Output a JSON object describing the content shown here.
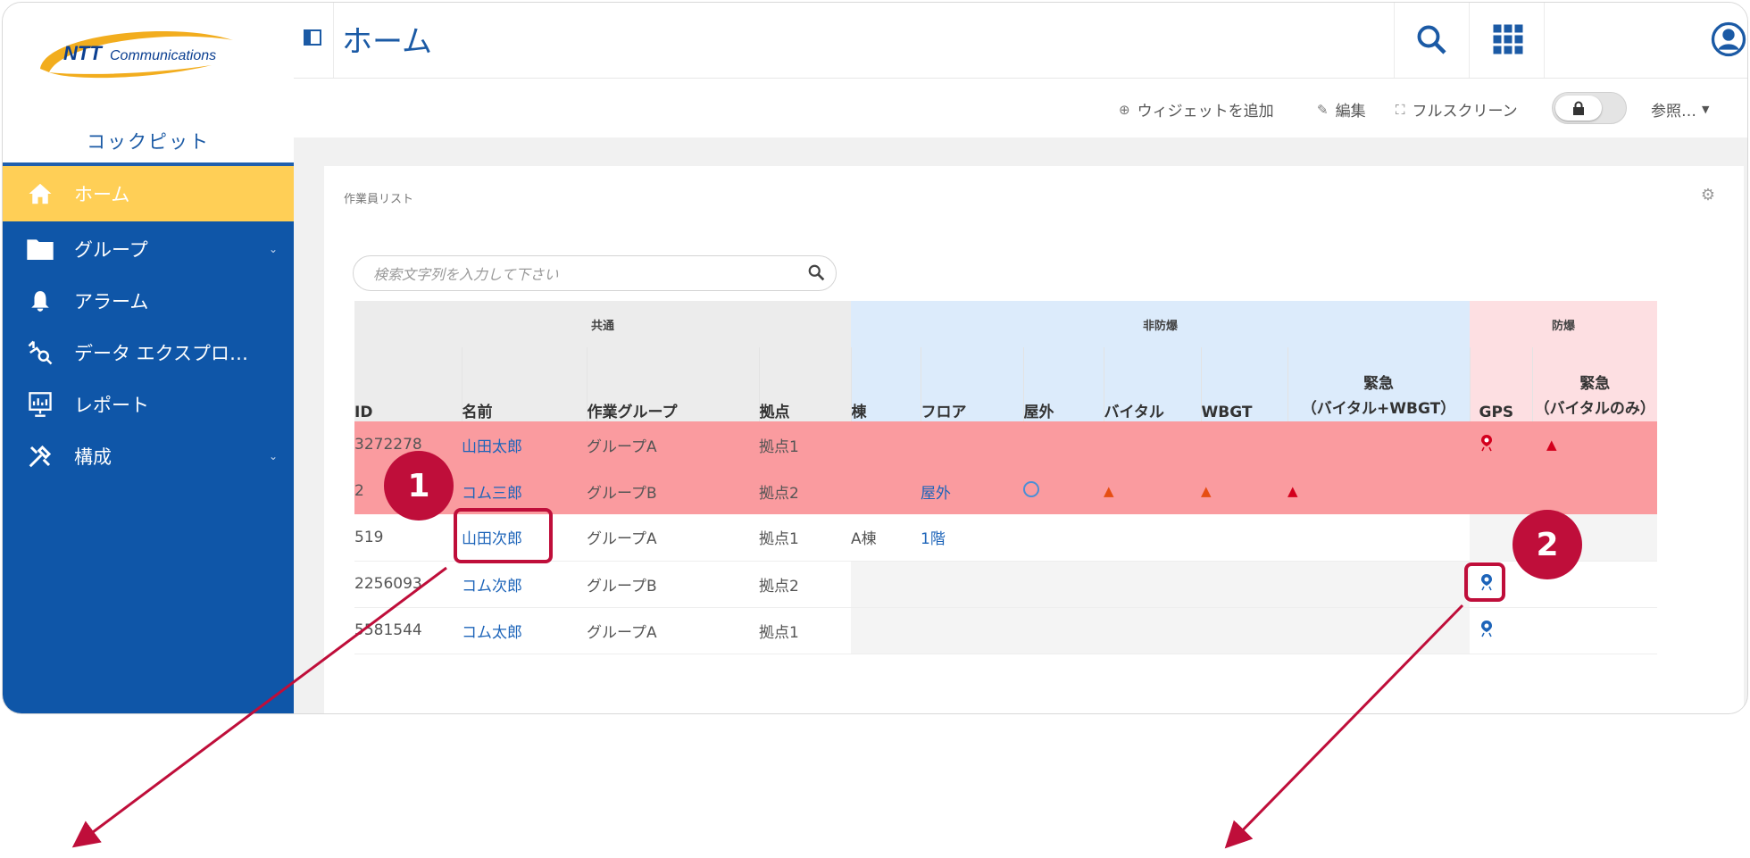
{
  "logo": {
    "text": "NTT Communications"
  },
  "sidebar": {
    "title": "コックピット",
    "items": [
      {
        "label": "ホーム",
        "icon": "home-icon",
        "active": true
      },
      {
        "label": "グループ",
        "icon": "folder-icon",
        "chevron": true
      },
      {
        "label": "アラーム",
        "icon": "bell-icon"
      },
      {
        "label": "データ エクスプロ…",
        "icon": "data-explorer-icon"
      },
      {
        "label": "レポート",
        "icon": "report-icon"
      },
      {
        "label": "構成",
        "icon": "tools-icon",
        "chevron": true
      }
    ]
  },
  "header": {
    "title": "ホーム"
  },
  "toolbar": {
    "add_widget": "ウィジェットを追加",
    "edit": "編集",
    "fullscreen": "フルスクリーン",
    "view": "参照…"
  },
  "card": {
    "title": "作業員リスト",
    "search_placeholder": "検索文字列を入力して下さい"
  },
  "table": {
    "groups": {
      "common": "共通",
      "non_explosion": "非防爆",
      "explosion": "防爆"
    },
    "columns": {
      "id": "ID",
      "name": "名前",
      "group": "作業グループ",
      "base": "拠点",
      "building": "棟",
      "floor": "フロア",
      "outdoor": "屋外",
      "vital": "バイタル",
      "wbgt": "WBGT",
      "emergency_a": "緊急",
      "emergency_a_sub": "（バイタル+WBGT）",
      "gps": "GPS",
      "emergency_b": "緊急",
      "emergency_b_sub": "（バイタルのみ）"
    },
    "rows": [
      {
        "id": "3272278",
        "name": "山田太郎",
        "group": "グループA",
        "base": "拠点1",
        "building": "",
        "floor": "",
        "alert": true
      },
      {
        "id": "2",
        "name": "コム三郎",
        "group": "グループB",
        "base": "拠点2",
        "building": "",
        "floor": "屋外",
        "alert": true
      },
      {
        "id": "519",
        "name": "山田次郎",
        "group": "グループA",
        "base": "拠点1",
        "building": "A棟",
        "floor": "1階",
        "alert": false
      },
      {
        "id": "2256093",
        "name": "コム次郎",
        "group": "グループB",
        "base": "拠点2",
        "building": "",
        "floor": "",
        "alert": false
      },
      {
        "id": "5581544",
        "name": "コム太郎",
        "group": "グループA",
        "base": "拠点1",
        "building": "",
        "floor": "",
        "alert": false
      }
    ]
  },
  "annotations": {
    "callout_1": "1",
    "callout_2": "2"
  },
  "colors": {
    "sidebar": "#0f56a8",
    "active": "#ffcf56",
    "alert_row": "#fa9b9f",
    "callout": "#bf0e3a"
  }
}
